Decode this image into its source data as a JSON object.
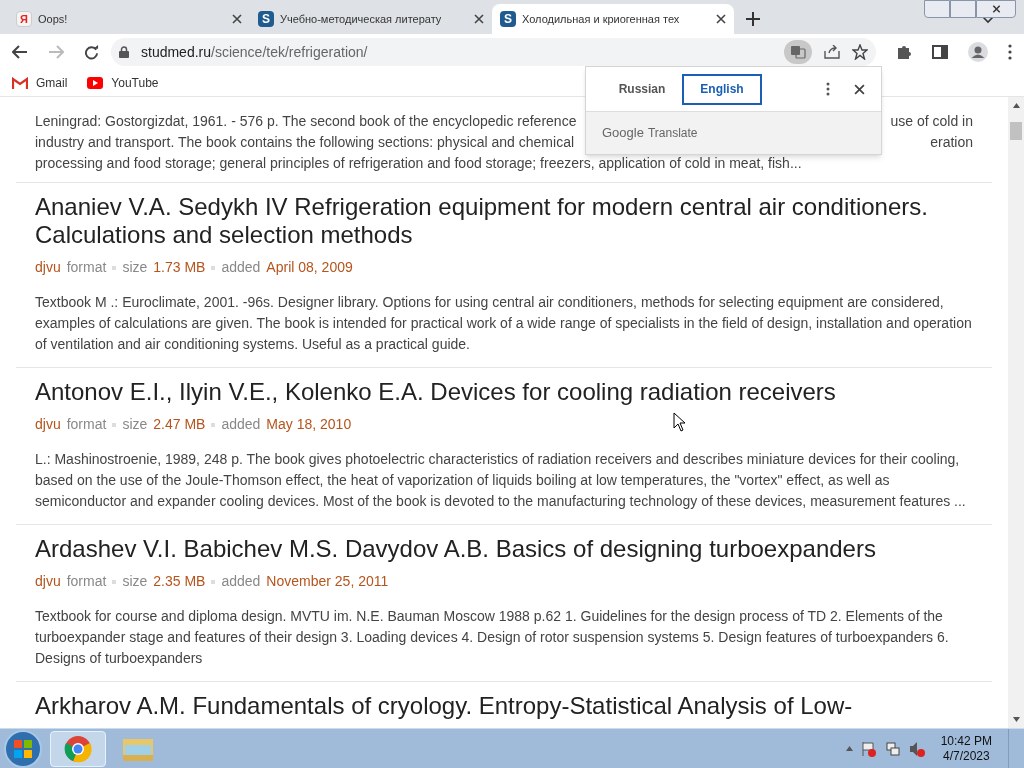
{
  "tabs": [
    {
      "title": "Oops!",
      "favicon": "Я",
      "kind": "yandex",
      "selected": false
    },
    {
      "title": "Учебно-методическая литерату",
      "favicon": "S",
      "kind": "studmed",
      "selected": false
    },
    {
      "title": "Холодильная и криогенная тех",
      "favicon": "S",
      "kind": "studmed",
      "selected": true
    }
  ],
  "address": {
    "host": "studmed.ru",
    "path": "/science/tek/refrigeration/"
  },
  "bookmarks": [
    {
      "label": "Gmail",
      "kind": "mail"
    },
    {
      "label": "YouTube",
      "kind": "video"
    }
  ],
  "translate_popup": {
    "languages": [
      {
        "label": "Russian",
        "selected": false
      },
      {
        "label": "English",
        "selected": true
      }
    ],
    "brand": "Google",
    "product": "Translate"
  },
  "partial_entry": {
    "lines": [
      {
        "left": "Leningrad: Gostorgizdat, 1961. - 576 p. The second book of the encyclopedic reference",
        "right": "use of cold in"
      },
      {
        "left": "industry and transport. The book contains the following sections: physical and chemical",
        "right": "eration"
      },
      {
        "left": "processing and food storage; general principles of refrigeration and food storage; freezers, application of cold in meat, fish..."
      }
    ]
  },
  "entries": [
    {
      "title": "Ananiev V.A. Sedykh IV Refrigeration equipment for modern central air conditioners. Calculations and selection methods",
      "format": "djvu",
      "format_label": "format",
      "size_label": "size",
      "size": "1.73 MB",
      "added_label": "added",
      "date": "April 08, 2009",
      "description": "Textbook M .: Euroclimate, 2001. -96s. Designer library. Options for using central air conditioners, methods for selecting equipment are considered, examples of calculations are given. The book is intended for practical work of a wide range of specialists in the field of design, installation and operation of ventilation and air conditioning systems. Useful as a practical guide."
    },
    {
      "title": "Antonov E.I., Ilyin V.E., Kolenko E.A. Devices for cooling radiation receivers",
      "format": "djvu",
      "format_label": "format",
      "size_label": "size",
      "size": "2.47 MB",
      "added_label": "added",
      "date": "May 18, 2010",
      "description": "L.: Mashinostroenie, 1989, 248 p. The book gives photoelectric characteristics of radiation receivers and describes miniature devices for their cooling, based on the use of the Joule-Thomson effect, the heat of vaporization of liquids boiling at low temperatures, the \"vortex\" effect, as well as semiconductor and expander cooling devices. Most of the book is devoted to the manufacturing technology of these devices, measurement features ..."
    },
    {
      "title": "Ardashev V.I. Babichev M.S. Davydov A.B. Basics of designing turboexpanders",
      "format": "djvu",
      "format_label": "format",
      "size_label": "size",
      "size": "2.35 MB",
      "added_label": "added",
      "date": "November 25, 2011",
      "description": "Textbook for course and diploma design. MVTU im. N.E. Bauman Moscow 1988 p.62 1. Guidelines for the design process of TD 2. Elements of the turboexpander stage and features of their design 3. Loading devices 4. Design of rotor suspension systems 5. Design features of turboexpanders 6. Designs of turboexpanders"
    },
    {
      "title": "Arkharov A.M. Fundamentals of cryology. Entropy-Statistical Analysis of Low-"
    }
  ],
  "taskbar": {
    "time": "10:42 PM",
    "date": "4/7/2023"
  }
}
